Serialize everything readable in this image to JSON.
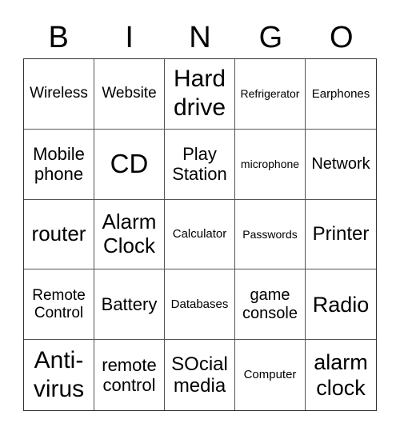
{
  "header": [
    "B",
    "I",
    "N",
    "G",
    "O"
  ],
  "cells": [
    "Wireless",
    "Website",
    "Hard drive",
    "Refrigerator",
    "Earphones",
    "Mobile phone",
    "CD",
    "Play Station",
    "microphone",
    "Network",
    "router",
    "Alarm Clock",
    "Calculator",
    "Passwords",
    "Printer",
    "Remote Control",
    "Battery",
    "Databases",
    "game console",
    "Radio",
    "Anti-virus",
    "remote control",
    "SOcial media",
    "Computer",
    "alarm clock"
  ]
}
